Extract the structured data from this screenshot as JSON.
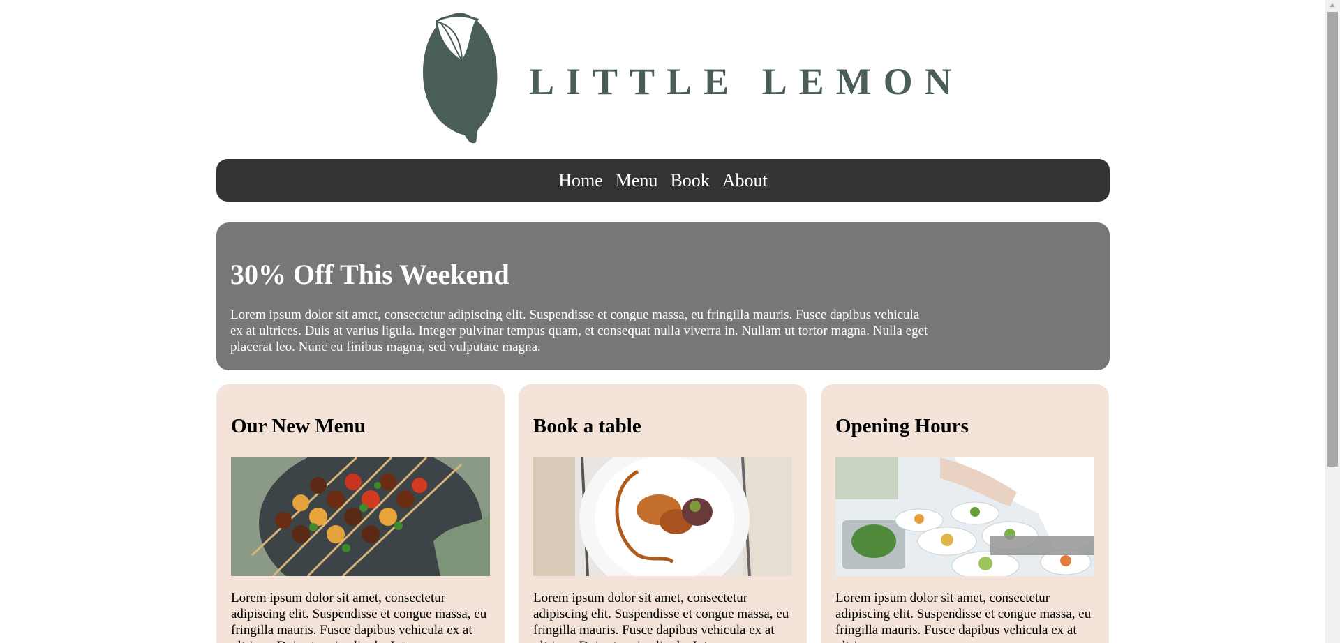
{
  "brand": {
    "name": "LITTLE LEMON",
    "logo_color": "#495e57"
  },
  "nav": {
    "items": [
      {
        "label": "Home"
      },
      {
        "label": "Menu"
      },
      {
        "label": "Book"
      },
      {
        "label": "About"
      }
    ]
  },
  "hero": {
    "title": "30% Off This Weekend",
    "body": "Lorem ipsum dolor sit amet, consectetur adipiscing elit. Suspendisse et congue massa, eu fringilla mauris. Fusce dapibus vehicula ex at ultrices. Duis at varius ligula. Integer pulvinar tempus quam, et consequat nulla viverra in. Nullam ut tortor magna. Nulla eget placerat leo. Nunc eu finibus magna, sed vulputate magna."
  },
  "cards": [
    {
      "title": "Our New Menu",
      "image": "grilled-skewers-photo",
      "body": "Lorem ipsum dolor sit amet, consectetur adipiscing elit. Suspendisse et congue massa, eu fringilla mauris. Fusce dapibus vehicula ex at ultrices. Duis at varius ligula. Integer"
    },
    {
      "title": "Book a table",
      "image": "plated-dish-photo",
      "body": "Lorem ipsum dolor sit amet, consectetur adipiscing elit. Suspendisse et congue massa, eu fringilla mauris. Fusce dapibus vehicula ex at ultrices. Duis at varius ligula. Integer"
    },
    {
      "title": "Opening Hours",
      "image": "chef-plating-photo",
      "body": "Lorem ipsum dolor sit amet, consectetur adipiscing elit. Suspendisse et congue massa, eu fringilla mauris. Fusce dapibus vehicula ex at ultrices."
    }
  ],
  "colors": {
    "nav_bg": "#333333",
    "hero_bg": "#777777",
    "card_bg": "#f3e3d8"
  }
}
